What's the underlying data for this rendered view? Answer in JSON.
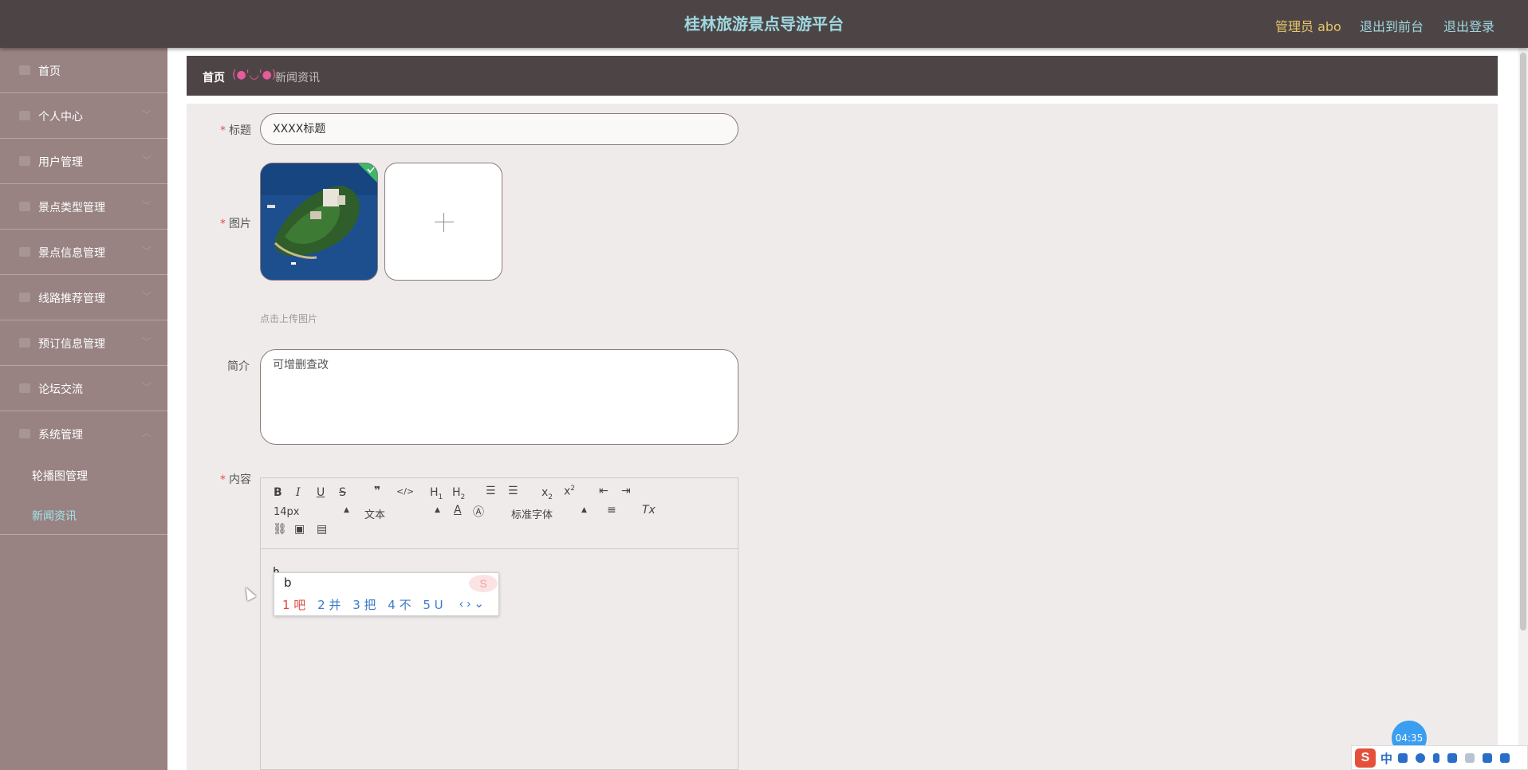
{
  "header": {
    "title": "桂林旅游景点导游平台",
    "admin_label": "管理员 abo",
    "front_link": "退出到前台",
    "logout_link": "退出登录"
  },
  "sidebar": {
    "items": [
      {
        "label": "首页",
        "icon": "home-icon",
        "has_arrow": false
      },
      {
        "label": "个人中心",
        "icon": "user-icon",
        "has_arrow": true
      },
      {
        "label": "用户管理",
        "icon": "grid-icon",
        "has_arrow": true
      },
      {
        "label": "景点类型管理",
        "icon": "grid-icon",
        "has_arrow": true
      },
      {
        "label": "景点信息管理",
        "icon": "grid-icon",
        "has_arrow": true
      },
      {
        "label": "线路推荐管理",
        "icon": "doc-icon",
        "has_arrow": true
      },
      {
        "label": "预订信息管理",
        "icon": "grid-icon",
        "has_arrow": true
      },
      {
        "label": "论坛交流",
        "icon": "grid-icon",
        "has_arrow": true
      },
      {
        "label": "系统管理",
        "icon": "settings-icon",
        "has_arrow": true,
        "expanded": true
      }
    ],
    "sub_items": [
      {
        "label": "轮播图管理",
        "active": false
      },
      {
        "label": "新闻资讯",
        "active": true
      }
    ]
  },
  "breadcrumb": {
    "home": "首页",
    "separator": "(●'◡'●)",
    "current": "新闻资讯"
  },
  "form": {
    "title_label": "标题",
    "title_value": "XXXX标题",
    "image_label": "图片",
    "upload_hint": "点击上传图片",
    "intro_label": "简介",
    "intro_value": "可增删查改",
    "content_label": "内容",
    "editor": {
      "font_size": "14px",
      "text_format": "文本",
      "font_family": "标准字体",
      "typed_text": "b"
    }
  },
  "ime_popup": {
    "composition": "b",
    "candidates": [
      "1 吧",
      "2 并",
      "3 把",
      "4 不",
      "5 U"
    ]
  },
  "system_tray": {
    "clock": "04:35",
    "mode": "中"
  },
  "colors": {
    "header_bg": "#4d4545",
    "sidebar_bg": "#988282",
    "title_color": "#9fd7e0",
    "admin_color": "#e8c66b",
    "active_sub": "#9fe6ec"
  }
}
